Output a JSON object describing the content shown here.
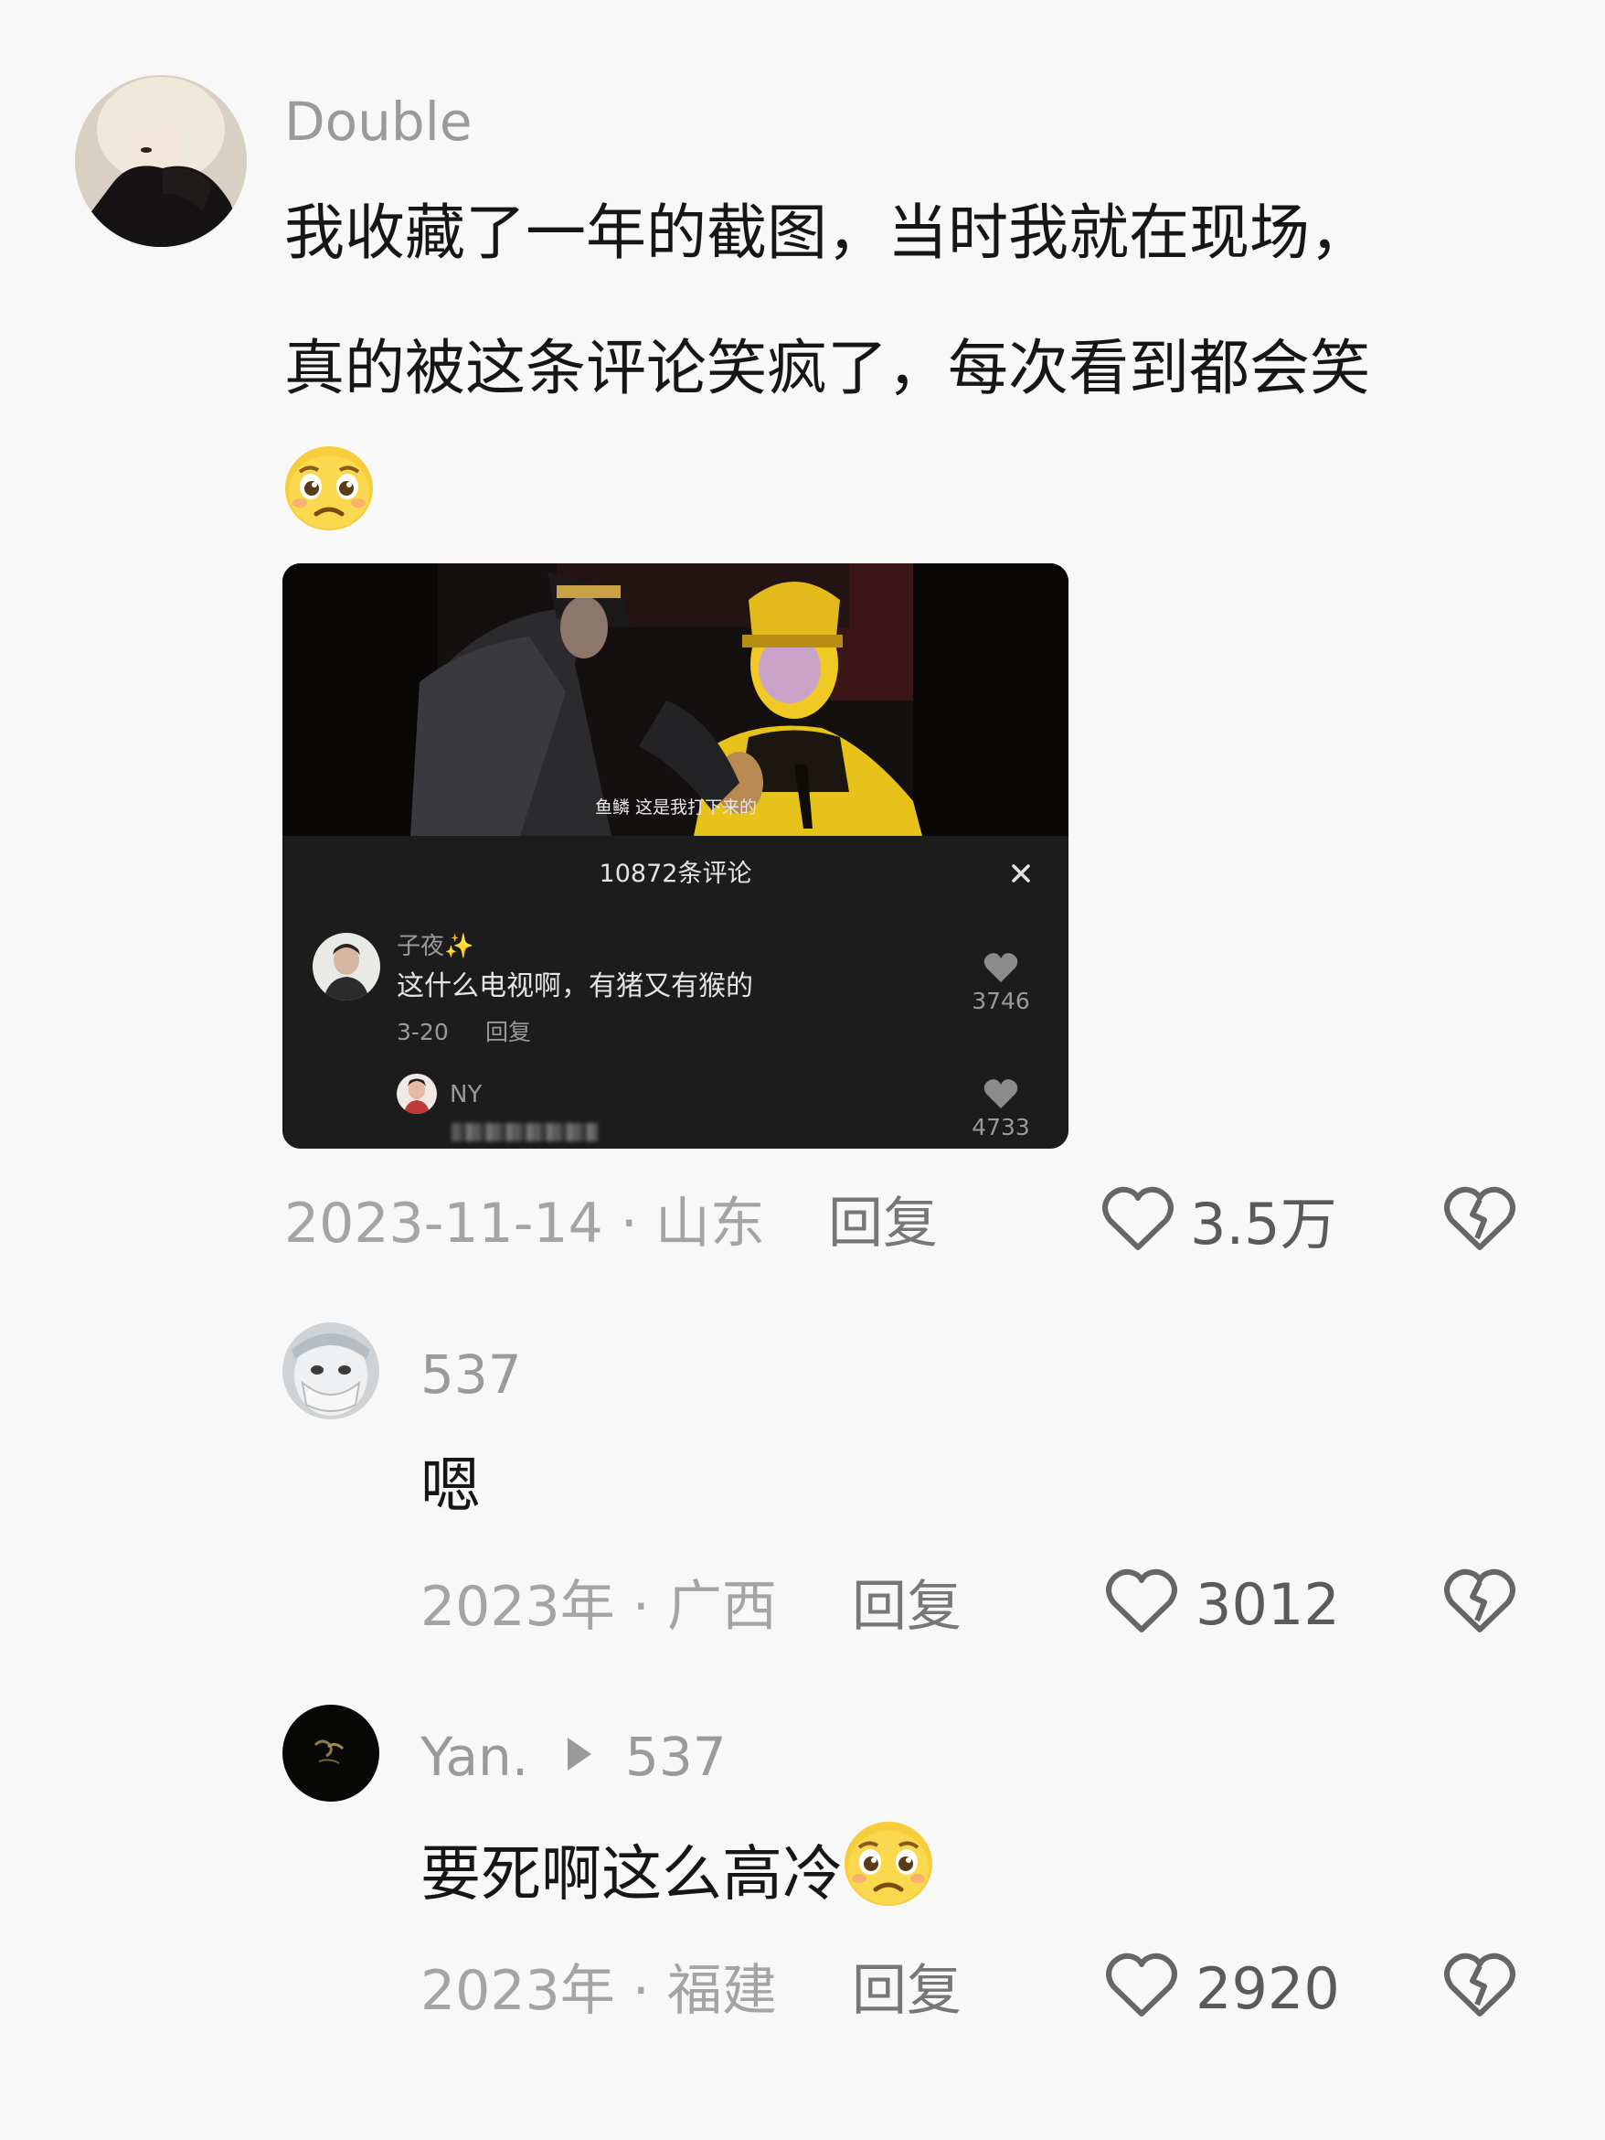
{
  "main_comment": {
    "username": "Double",
    "text_line1": "我收藏了一年的截图，当时我就在现场，",
    "text_line2": "真的被这条评论笑疯了，每次看到都会笑",
    "emoji": "pleading-face",
    "date_location": "2023-11-14 · 山东",
    "reply_label": "回复",
    "likes": "3.5万"
  },
  "embedded_screenshot": {
    "video_subtitle": "鱼鳞 这是我打下来的",
    "comments_header": "10872条评论",
    "close_icon": "close-icon",
    "comment1": {
      "username": "子夜",
      "username_emoji": "✨",
      "text": "这什么电视啊，有猪又有猴的",
      "date": "3-20",
      "reply_label": "回复",
      "likes": "3746"
    },
    "comment2": {
      "username": "NY",
      "likes": "4733"
    }
  },
  "replies": [
    {
      "username": "537",
      "text": "嗯",
      "date_location": "2023年 · 广西",
      "reply_label": "回复",
      "likes": "3012"
    },
    {
      "username": "Yan.",
      "reply_to": "537",
      "text": "要死啊这么高冷",
      "emoji": "pleading-face",
      "date_location": "2023年 · 福建",
      "reply_label": "回复",
      "likes": "2920"
    }
  ],
  "icons": {
    "like": "heart-outline-icon",
    "dislike": "broken-heart-icon",
    "reply_arrow": "play-triangle-icon"
  },
  "colors": {
    "background": "#f8f8f8",
    "text": "#161616",
    "secondary": "#a4a4a4",
    "costume_yellow": "#f0c417"
  }
}
